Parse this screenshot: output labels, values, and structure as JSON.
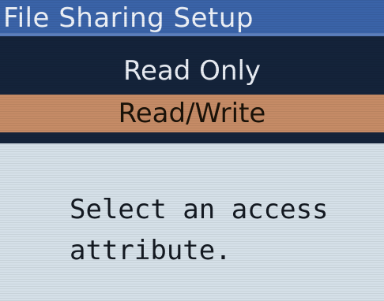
{
  "title": "File Sharing Setup",
  "menu": {
    "items": [
      {
        "label": "Read Only",
        "selected": false
      },
      {
        "label": "Read/Write",
        "selected": true
      }
    ]
  },
  "message": {
    "line1": "Select an access",
    "line2": "attribute."
  },
  "colors": {
    "title_bar": "#3a63a8",
    "menu_background": "#14233a",
    "selected_item": "#c58b66",
    "message_background": "#d5e0e8"
  }
}
